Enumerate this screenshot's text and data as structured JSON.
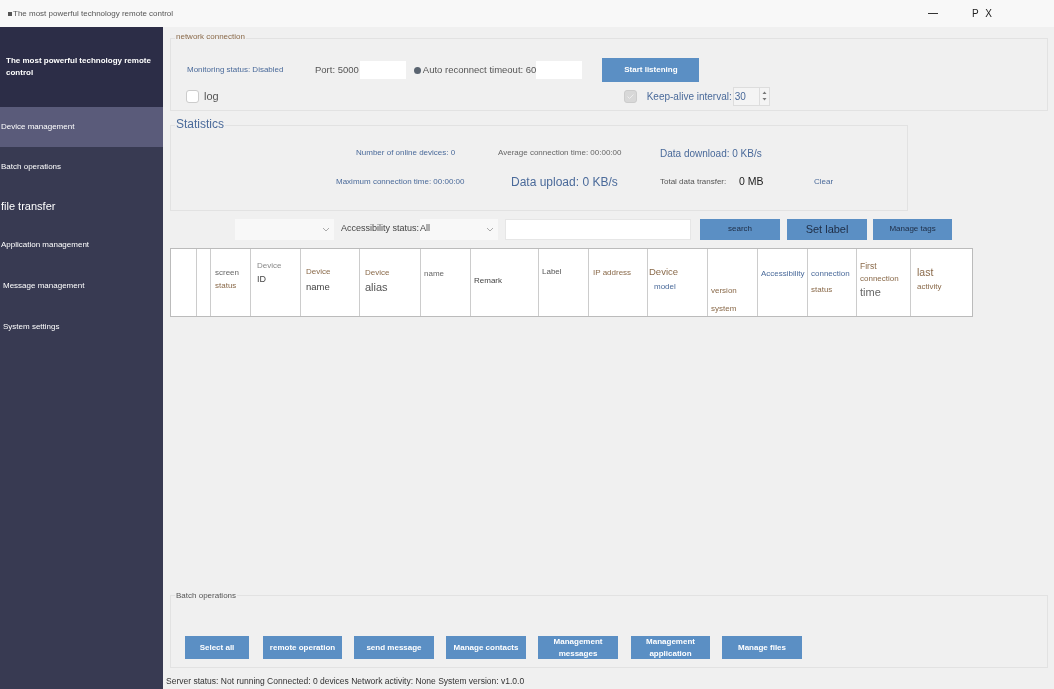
{
  "window": {
    "title": "The most powerful technology remote control",
    "controls": "P X"
  },
  "sidebar": {
    "title": "The most powerful technology remote control",
    "items": [
      {
        "label": "Device management",
        "selected": true
      },
      {
        "label": "Batch operations",
        "selected": false
      },
      {
        "label": "file transfer",
        "selected": false
      },
      {
        "label": "Application management",
        "selected": false
      },
      {
        "label": "Message management",
        "selected": false
      },
      {
        "label": "System settings",
        "selected": false
      }
    ]
  },
  "network": {
    "title": "network connection",
    "monitoring_status": "Monitoring status: Disabled",
    "port_label": "Port: 5000",
    "reconnect_label": "Auto reconnect timeout: 60",
    "start_button": "Start listening",
    "log": {
      "label": "log",
      "checked": false
    },
    "keep_alive": {
      "label": "Keep-alive interval:",
      "checked": true,
      "disabled": true,
      "value": "30"
    }
  },
  "statistics": {
    "title": "Statistics",
    "online_devices": "Number of online devices: 0",
    "average_time": "Average connection time: 00:00:00",
    "download": "Data download: 0 KB/s",
    "max_time": "Maximum connection time: 00:00:00",
    "upload": "Data upload: 0 KB/s",
    "total_label": "Total data transfer:",
    "total_value": "0 MB",
    "clear": "Clear"
  },
  "filters": {
    "accessibility_label": "Accessibility status:",
    "accessibility_value": "All",
    "buttons": [
      "search",
      "Set label",
      "Manage tags"
    ]
  },
  "table": {
    "columns": [
      {},
      {},
      {
        "lines": [
          "screen",
          "status"
        ]
      },
      {
        "lines": [
          "Device",
          "ID"
        ]
      },
      {
        "lines": [
          "Device",
          "name"
        ]
      },
      {
        "lines": [
          "Device",
          "alias"
        ]
      },
      {
        "lines": [
          "name"
        ]
      },
      {
        "lines": [
          "Remark"
        ]
      },
      {
        "lines": [
          "Label"
        ]
      },
      {
        "lines": [
          "IP address"
        ]
      },
      {
        "lines": [
          "Device",
          "model"
        ]
      },
      {
        "lines": [
          "version",
          "system"
        ]
      },
      {
        "lines": [
          "Accessibility"
        ]
      },
      {
        "lines": [
          "connection",
          "status"
        ]
      },
      {
        "lines": [
          "First",
          "connection",
          "time"
        ]
      },
      {
        "lines": [
          "last",
          "activity"
        ]
      }
    ]
  },
  "batch": {
    "title": "Batch operations",
    "buttons": [
      "Select all",
      "remote operation",
      "send message",
      "Manage contacts",
      "Management messages",
      "Management application",
      "Manage files"
    ]
  },
  "status_bar": "Server status: Not running Connected: 0 devices Network activity: None System version: v1.0.0"
}
